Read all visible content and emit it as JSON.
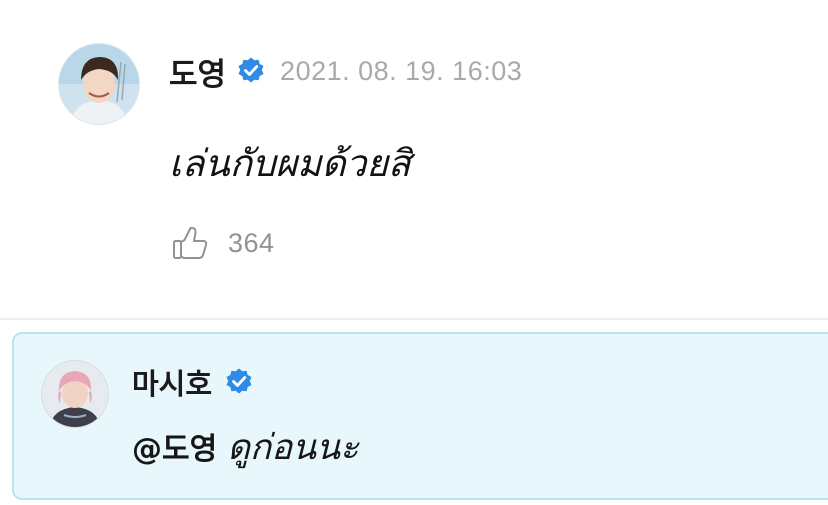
{
  "post": {
    "author": "도영",
    "timestamp": "2021. 08. 19. 16:03",
    "text": "เล่นกับผมด้วยสิ",
    "like_count": "364"
  },
  "reply": {
    "author": "마시호",
    "mention": "@도영",
    "text": "ดูก่อนนะ"
  },
  "icons": {
    "verified": "verified-badge-icon",
    "like": "thumbs-up-icon"
  },
  "colors": {
    "verified_blue": "#2f8be8",
    "reply_background": "#e8f7fc",
    "reply_border": "#b9e4f1",
    "timestamp_gray": "#a7a9ad"
  }
}
